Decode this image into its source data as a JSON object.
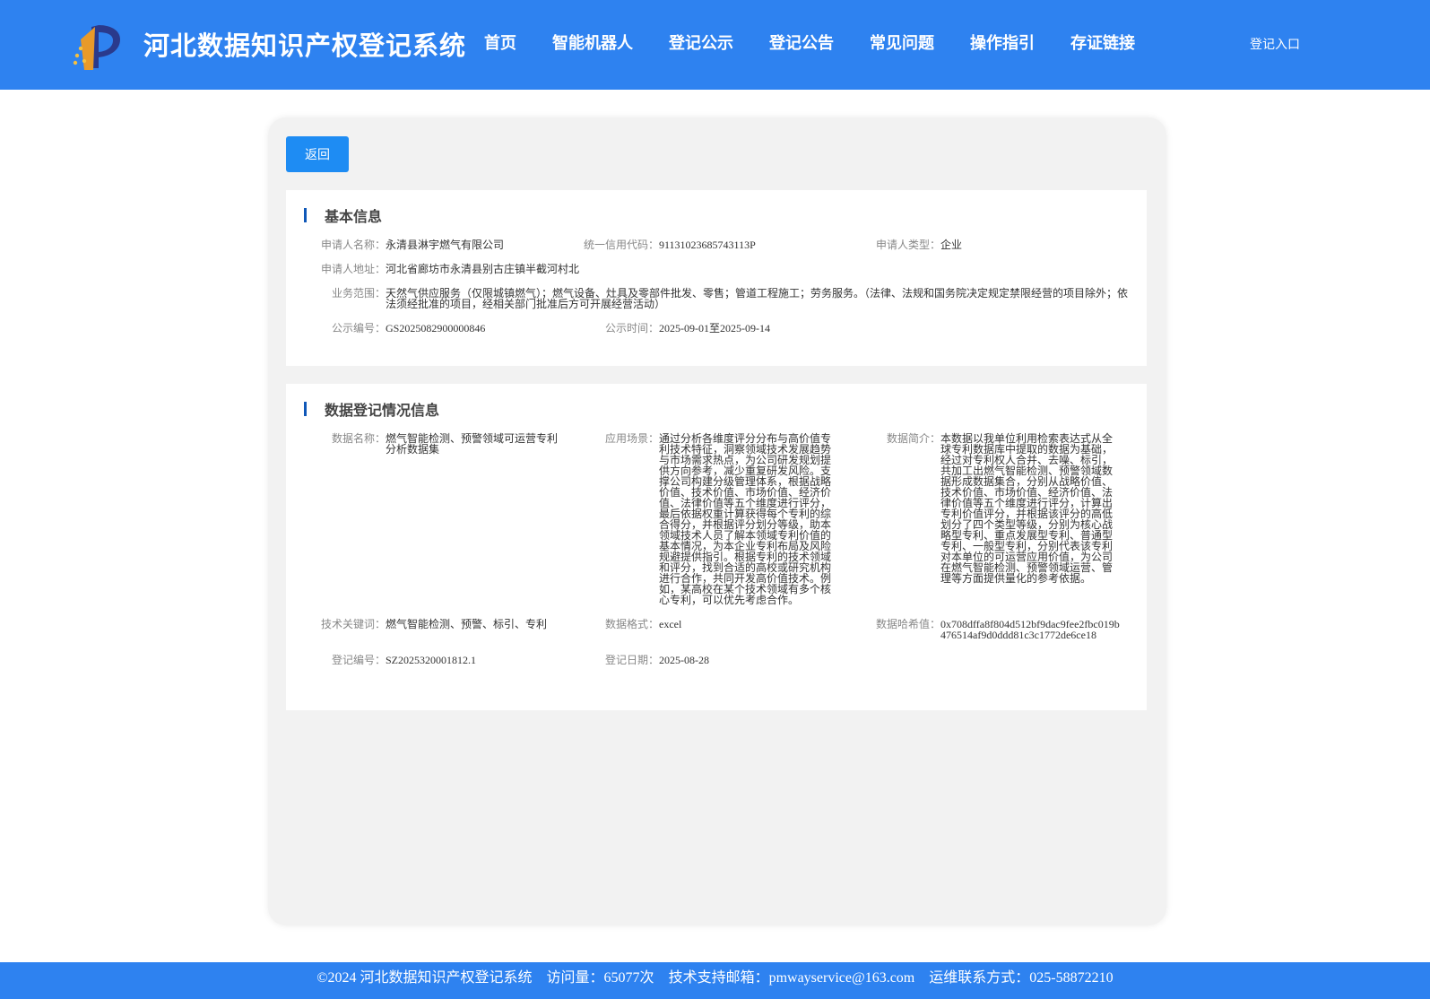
{
  "header": {
    "site_title": "河北数据知识产权登记系统",
    "nav": [
      "首页",
      "智能机器人",
      "登记公示",
      "登记公告",
      "常见问题",
      "操作指引",
      "存证链接"
    ],
    "login_label": "登记入口"
  },
  "toolbar": {
    "back_label": "返回"
  },
  "basic_info": {
    "title": "基本信息",
    "applicant_name_label": "申请人名称：",
    "applicant_name": "永清县淋宇燃气有限公司",
    "credit_code_label": "统一信用代码：",
    "credit_code": "91131023685743113P",
    "applicant_type_label": "申请人类型：",
    "applicant_type": "企业",
    "address_label": "申请人地址：",
    "address": "河北省廊坊市永清县别古庄镇半截河村北",
    "scope_label": "业务范围：",
    "scope": "天然气供应服务（仅限城镇燃气）；燃气设备、灶具及零部件批发、零售；管道工程施工；劳务服务。（法律、法规和国务院决定规定禁限经营的项目除外；依法须经批准的项目，经相关部门批准后方可开展经营活动）",
    "notice_no_label": "公示编号：",
    "notice_no": "GS2025082900000846",
    "notice_time_label": "公示时间：",
    "notice_time": "2025-09-01至2025-09-14"
  },
  "data_info": {
    "title": "数据登记情况信息",
    "data_name_label": "数据名称：",
    "data_name": "燃气智能检测、预警领域可运营专利分析数据集",
    "scenario_label": "应用场景：",
    "scenario": "通过分析各维度评分分布与高价值专利技术特征，洞察领域技术发展趋势与市场需求热点，为公司研发规划提供方向参考，减少重复研发风险。支撑公司构建分级管理体系，根据战略价值、技术价值、市场价值、经济价值、法律价值等五个维度进行评分，最后依据权重计算获得每个专利的综合得分，并根据评分划分等级，助本领域技术人员了解本领域专利价值的基本情况，为本企业专利布局及风险规避提供指引。根据专利的技术领域和评分，找到合适的高校或研究机构进行合作，共同开发高价值技术。例如，某高校在某个技术领域有多个核心专利，可以优先考虑合作。",
    "intro_label": "数据简介：",
    "intro": "本数据以我单位利用检索表达式从全球专利数据库中提取的数据为基础，经过对专利权人合并、去噪、标引，共加工出燃气智能检测、预警领域数据形成数据集合，分别从战略价值、技术价值、市场价值、经济价值、法律价值等五个维度进行评分，计算出专利价值评分，并根据该评分的高低划分了四个类型等级，分别为核心战略型专利、重点发展型专利、普通型专利、一般型专利，分别代表该专利对本单位的可运营应用价值，为公司在燃气智能检测、预警领域运营、管理等方面提供量化的参考依据。",
    "keywords_label": "技术关键词：",
    "keywords": "燃气智能检测、预警、标引、专利",
    "format_label": "数据格式：",
    "format": "excel",
    "hash_label": "数据哈希值：",
    "hash": "0x708dffa8f804d512bf9dac9fee2fbc019b476514af9d0ddd81c3c1772de6ce18",
    "reg_no_label": "登记编号：",
    "reg_no": "SZ2025320001812.1",
    "reg_date_label": "登记日期：",
    "reg_date": "2025-08-28"
  },
  "footer": {
    "copyright": "©2024 河北数据知识产权登记系统",
    "visits": "访问量：65077次",
    "email": "技术支持邮箱：pmwayservice@163.com",
    "phone": "运维联系方式：025-58872210"
  }
}
